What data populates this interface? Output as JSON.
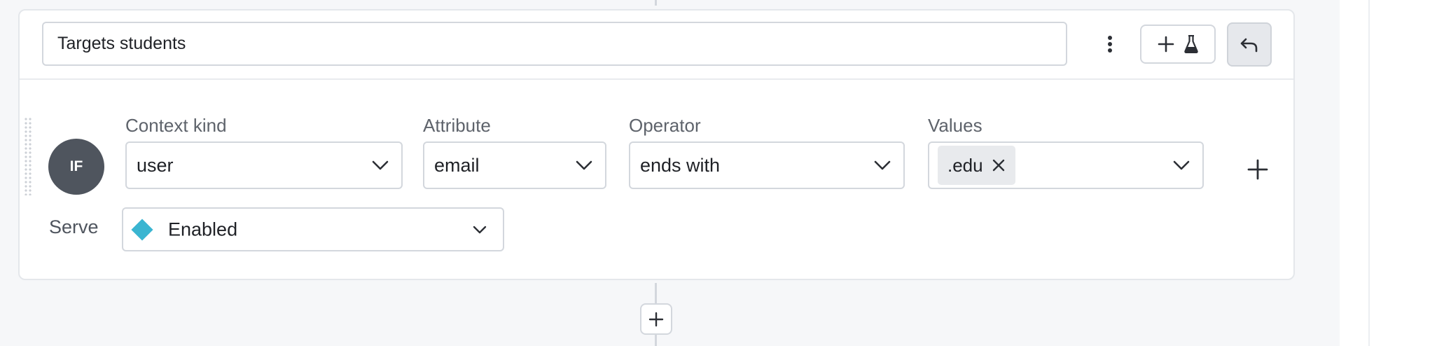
{
  "rule": {
    "name": "Targets students",
    "if_label": "IF",
    "clause": {
      "context_kind": {
        "label": "Context kind",
        "value": "user"
      },
      "attribute": {
        "label": "Attribute",
        "value": "email"
      },
      "operator": {
        "label": "Operator",
        "value": "ends with"
      },
      "values": {
        "label": "Values",
        "chips": [
          ".edu"
        ]
      }
    },
    "serve": {
      "label": "Serve",
      "value": "Enabled",
      "variation_color": "#3ab5d1"
    }
  },
  "icons": {
    "menu": "more-vertical-icon",
    "add": "plus-icon",
    "test": "flask-icon",
    "undo": "undo-icon",
    "remove_chip": "close-icon",
    "dropdown": "chevron-down-icon"
  },
  "colors": {
    "badge": "#4f555e",
    "border": "#d3d7dd",
    "chip_bg": "#e8eaed"
  }
}
